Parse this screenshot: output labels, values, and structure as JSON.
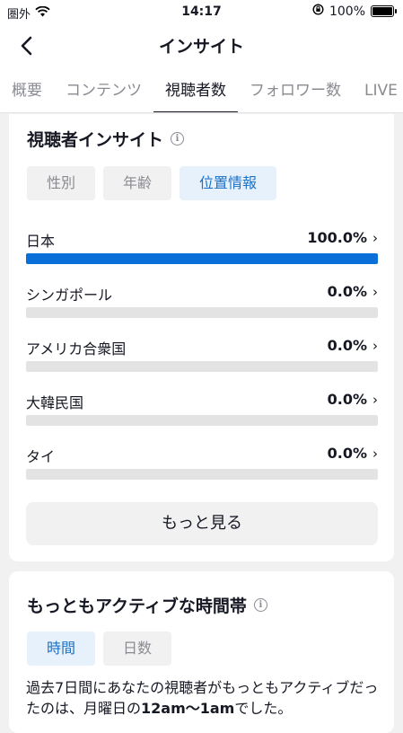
{
  "status_bar": {
    "carrier": "圏外",
    "time": "14:17",
    "battery": "100%"
  },
  "nav": {
    "title": "インサイト"
  },
  "tabs": [
    {
      "label": "概要"
    },
    {
      "label": "コンテンツ"
    },
    {
      "label": "視聴者数"
    },
    {
      "label": "フォロワー数"
    },
    {
      "label": "LIVE"
    }
  ],
  "audience": {
    "title": "視聴者インサイト",
    "chips": [
      "性別",
      "年齢",
      "位置情報"
    ],
    "rows": [
      {
        "name": "日本",
        "pct": "100.0%",
        "value": 1.0
      },
      {
        "name": "シンガポール",
        "pct": "0.0%",
        "value": 0.0
      },
      {
        "name": "アメリカ合衆国",
        "pct": "0.0%",
        "value": 0.0
      },
      {
        "name": "大韓民国",
        "pct": "0.0%",
        "value": 0.0
      },
      {
        "name": "タイ",
        "pct": "0.0%",
        "value": 0.0
      }
    ],
    "more_label": "もっと見る"
  },
  "active_times": {
    "title": "もっともアクティブな時間帯",
    "chips": [
      "時間",
      "日数"
    ],
    "desc_prefix": "過去7日間にあなたの視聴者がもっともアクティブだったのは、月曜日の",
    "desc_bold": "12am〜1am",
    "desc_suffix": "でした。"
  },
  "colors": {
    "accent": "#1d71c6",
    "bar": "#0a6fd8"
  }
}
